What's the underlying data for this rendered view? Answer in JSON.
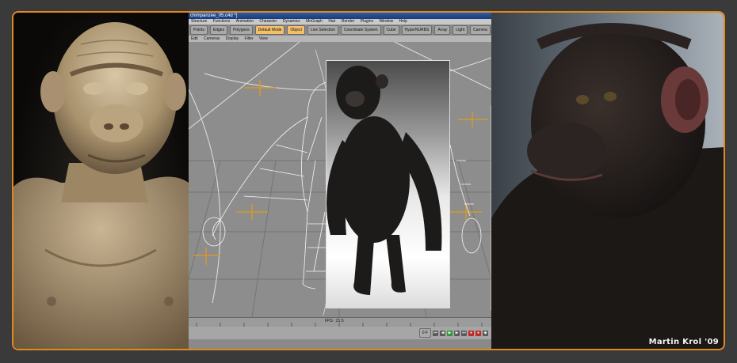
{
  "window": {
    "title": "chimpanzee_05.c4d *]"
  },
  "menubar": {
    "items": [
      "Structure",
      "Functions",
      "Animation",
      "Character",
      "Dynamics",
      "MoGraph",
      "Hair",
      "Render",
      "Plugins",
      "Window",
      "Help"
    ]
  },
  "toolbar": {
    "items": [
      {
        "label": "Points",
        "active": false
      },
      {
        "label": "Edges",
        "active": false
      },
      {
        "label": "Polygons",
        "active": false
      },
      {
        "label": "Default Mode",
        "active": true
      },
      {
        "label": "Object",
        "active": true
      },
      {
        "label": "Live Selection",
        "active": false
      },
      {
        "label": "Coordinate System",
        "active": false
      },
      {
        "label": "Cube",
        "active": false
      },
      {
        "label": "HyperNURBS",
        "active": false
      },
      {
        "label": "Array",
        "active": false
      },
      {
        "label": "Light",
        "active": false
      },
      {
        "label": "Camera",
        "active": false
      }
    ]
  },
  "viewport_menu": {
    "items": [
      "Edit",
      "Cameras",
      "Display",
      "Filter",
      "View"
    ]
  },
  "viewport": {
    "fps_label": "FPS : 21.5"
  },
  "timeline": {
    "frame_field": "0 F"
  },
  "credit": {
    "text": "Martin Krol '09"
  },
  "colors": {
    "frame_border": "#e08a1e",
    "titlebar": "#2b5aa8",
    "active_tool": "#f2c06b",
    "play_green": "#2a9a36",
    "record_red": "#c02a2a"
  }
}
